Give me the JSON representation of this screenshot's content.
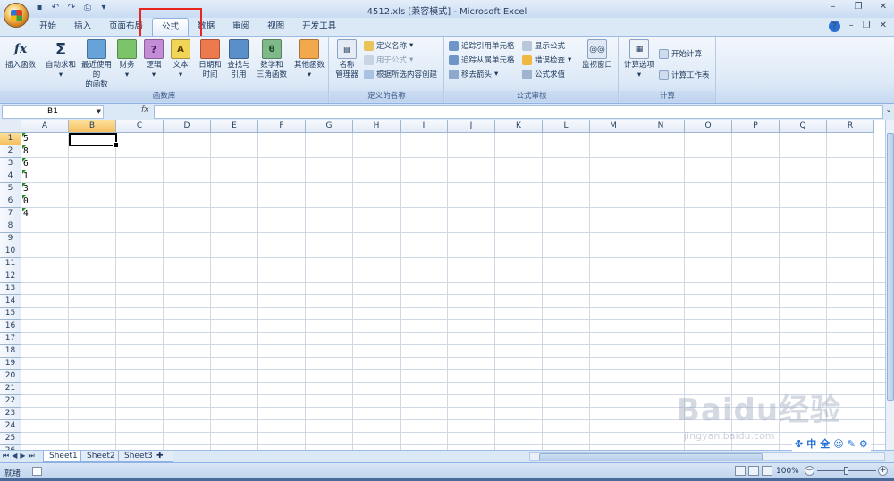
{
  "window": {
    "title": "4512.xls  [兼容模式] - Microsoft Excel"
  },
  "tabs": [
    "开始",
    "插入",
    "页面布局",
    "公式",
    "数据",
    "审阅",
    "视图",
    "开发工具"
  ],
  "active_tab": "公式",
  "ribbon": {
    "function_library": {
      "label": "函数库",
      "insert_function": "插入函数",
      "autosum": "自动求和",
      "recent_1": "最近使用的",
      "recent_2": "的函数",
      "financial": "财务",
      "logical": "逻辑",
      "text": "文本",
      "datetime_1": "日期和",
      "datetime_2": "时间",
      "lookup_1": "查找与",
      "lookup_2": "引用",
      "math_1": "数学和",
      "math_2": "三角函数",
      "more": "其他函数"
    },
    "defined_names": {
      "label": "定义的名称",
      "name_manager_1": "名称",
      "name_manager_2": "管理器",
      "define_name": "定义名称",
      "use_in_formula": "用于公式",
      "create_from_selection": "根据所选内容创建"
    },
    "formula_auditing": {
      "label": "公式审核",
      "trace_precedents": "追踪引用单元格",
      "trace_dependents": "追踪从属单元格",
      "remove_arrows": "移去箭头",
      "show_formulas": "显示公式",
      "error_checking": "错误检查",
      "evaluate_formula": "公式求值",
      "watch_window": "监视窗口"
    },
    "calculation": {
      "label": "计算",
      "calc_options": "计算选项",
      "calc_now": "开始计算",
      "calc_sheet": "计算工作表"
    }
  },
  "formula_bar": {
    "name_box": "B1",
    "fx": "fx",
    "value": ""
  },
  "grid": {
    "columns": [
      "A",
      "B",
      "C",
      "D",
      "E",
      "F",
      "G",
      "H",
      "I",
      "J",
      "K",
      "L",
      "M",
      "N",
      "O",
      "P",
      "Q",
      "R"
    ],
    "rows": [
      "1",
      "2",
      "3",
      "4",
      "5",
      "6",
      "7",
      "8",
      "9",
      "10",
      "11",
      "12",
      "13",
      "14",
      "15",
      "16",
      "17",
      "18",
      "19",
      "20",
      "21",
      "22",
      "23",
      "24",
      "25",
      "26"
    ],
    "column_a_values": [
      "5",
      "8",
      "6",
      "1",
      "3",
      "0",
      "4"
    ],
    "active_cell": "B1"
  },
  "sheets": [
    "Sheet1",
    "Sheet2",
    "Sheet3"
  ],
  "active_sheet": "Sheet1",
  "status": {
    "ready": "就绪",
    "zoom": "100%"
  },
  "ime": [
    "中",
    "全"
  ],
  "watermark": {
    "brand": "Baidu经验",
    "url": "jingyan.baidu.com"
  },
  "colors": {
    "accent": "#1e395b",
    "highlight": "#e8251f",
    "ribbon": "#dbe8f6"
  }
}
